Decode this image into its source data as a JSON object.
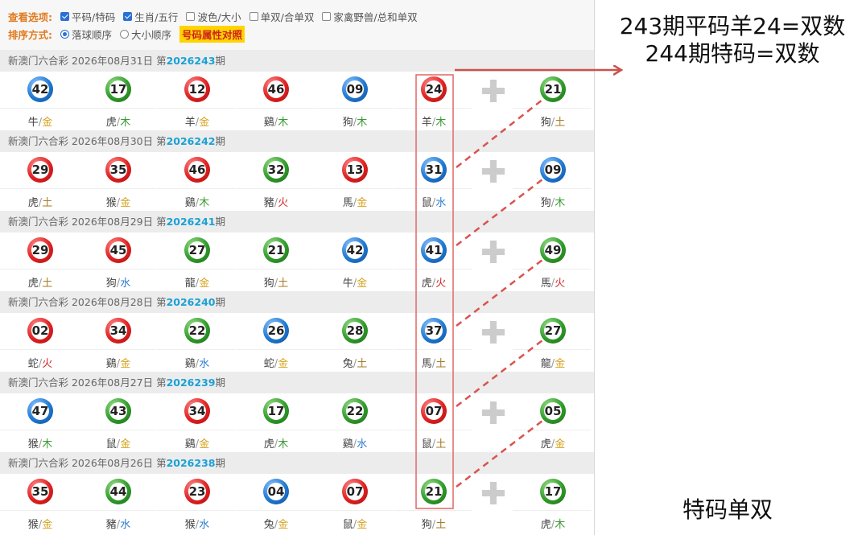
{
  "options": {
    "view_label": "查看选项:",
    "view_items": [
      {
        "label": "平码/特码",
        "checked": true
      },
      {
        "label": "生肖/五行",
        "checked": true
      },
      {
        "label": "波色/大小",
        "checked": false
      },
      {
        "label": "单双/合单双",
        "checked": false
      },
      {
        "label": "家禽野兽/总和单双",
        "checked": false
      }
    ],
    "sort_label": "排序方式:",
    "sort_items": [
      {
        "label": "落球顺序",
        "checked": true
      },
      {
        "label": "大小顺序",
        "checked": false
      }
    ],
    "highlight_link": "号码属性对照"
  },
  "draws": [
    {
      "title": "新澳门六合彩 2026年08月31日 第",
      "issue": "2026243",
      "suffix": "期",
      "balls": [
        {
          "num": "42",
          "color": "blue",
          "zodiac": "牛",
          "element": "金"
        },
        {
          "num": "17",
          "color": "green",
          "zodiac": "虎",
          "element": "木"
        },
        {
          "num": "12",
          "color": "red",
          "zodiac": "羊",
          "element": "金"
        },
        {
          "num": "46",
          "color": "red",
          "zodiac": "鷄",
          "element": "木"
        },
        {
          "num": "09",
          "color": "blue",
          "zodiac": "狗",
          "element": "木"
        },
        {
          "num": "24",
          "color": "red",
          "zodiac": "羊",
          "element": "木"
        }
      ],
      "special": {
        "num": "21",
        "color": "green",
        "zodiac": "狗",
        "element": "土"
      }
    },
    {
      "title": "新澳门六合彩 2026年08月30日 第",
      "issue": "2026242",
      "suffix": "期",
      "balls": [
        {
          "num": "29",
          "color": "red",
          "zodiac": "虎",
          "element": "土"
        },
        {
          "num": "35",
          "color": "red",
          "zodiac": "猴",
          "element": "金"
        },
        {
          "num": "46",
          "color": "red",
          "zodiac": "鷄",
          "element": "木"
        },
        {
          "num": "32",
          "color": "green",
          "zodiac": "豬",
          "element": "火"
        },
        {
          "num": "13",
          "color": "red",
          "zodiac": "馬",
          "element": "金"
        },
        {
          "num": "31",
          "color": "blue",
          "zodiac": "鼠",
          "element": "水"
        }
      ],
      "special": {
        "num": "09",
        "color": "blue",
        "zodiac": "狗",
        "element": "木"
      }
    },
    {
      "title": "新澳门六合彩 2026年08月29日 第",
      "issue": "2026241",
      "suffix": "期",
      "balls": [
        {
          "num": "29",
          "color": "red",
          "zodiac": "虎",
          "element": "土"
        },
        {
          "num": "45",
          "color": "red",
          "zodiac": "狗",
          "element": "水"
        },
        {
          "num": "27",
          "color": "green",
          "zodiac": "龍",
          "element": "金"
        },
        {
          "num": "21",
          "color": "green",
          "zodiac": "狗",
          "element": "土"
        },
        {
          "num": "42",
          "color": "blue",
          "zodiac": "牛",
          "element": "金"
        },
        {
          "num": "41",
          "color": "blue",
          "zodiac": "虎",
          "element": "火"
        }
      ],
      "special": {
        "num": "49",
        "color": "green",
        "zodiac": "馬",
        "element": "火"
      }
    },
    {
      "title": "新澳门六合彩 2026年08月28日 第",
      "issue": "2026240",
      "suffix": "期",
      "balls": [
        {
          "num": "02",
          "color": "red",
          "zodiac": "蛇",
          "element": "火"
        },
        {
          "num": "34",
          "color": "red",
          "zodiac": "鷄",
          "element": "金"
        },
        {
          "num": "22",
          "color": "green",
          "zodiac": "鷄",
          "element": "水"
        },
        {
          "num": "26",
          "color": "blue",
          "zodiac": "蛇",
          "element": "金"
        },
        {
          "num": "28",
          "color": "green",
          "zodiac": "兔",
          "element": "土"
        },
        {
          "num": "37",
          "color": "blue",
          "zodiac": "馬",
          "element": "土"
        }
      ],
      "special": {
        "num": "27",
        "color": "green",
        "zodiac": "龍",
        "element": "金"
      }
    },
    {
      "title": "新澳门六合彩 2026年08月27日 第",
      "issue": "2026239",
      "suffix": "期",
      "balls": [
        {
          "num": "47",
          "color": "blue",
          "zodiac": "猴",
          "element": "木"
        },
        {
          "num": "43",
          "color": "green",
          "zodiac": "鼠",
          "element": "金"
        },
        {
          "num": "34",
          "color": "red",
          "zodiac": "鷄",
          "element": "金"
        },
        {
          "num": "17",
          "color": "green",
          "zodiac": "虎",
          "element": "木"
        },
        {
          "num": "22",
          "color": "green",
          "zodiac": "鷄",
          "element": "水"
        },
        {
          "num": "07",
          "color": "red",
          "zodiac": "鼠",
          "element": "土"
        }
      ],
      "special": {
        "num": "05",
        "color": "green",
        "zodiac": "虎",
        "element": "金"
      }
    },
    {
      "title": "新澳门六合彩 2026年08月26日 第",
      "issue": "2026238",
      "suffix": "期",
      "balls": [
        {
          "num": "35",
          "color": "red",
          "zodiac": "猴",
          "element": "金"
        },
        {
          "num": "44",
          "color": "green",
          "zodiac": "豬",
          "element": "水"
        },
        {
          "num": "23",
          "color": "red",
          "zodiac": "猴",
          "element": "水"
        },
        {
          "num": "04",
          "color": "blue",
          "zodiac": "兔",
          "element": "金"
        },
        {
          "num": "07",
          "color": "red",
          "zodiac": "鼠",
          "element": "金"
        },
        {
          "num": "21",
          "color": "green",
          "zodiac": "狗",
          "element": "土"
        }
      ],
      "special": {
        "num": "17",
        "color": "green",
        "zodiac": "虎",
        "element": "木"
      }
    }
  ],
  "annotations": {
    "line1": "243期平码羊24=双数",
    "line2": "244期特码=双数",
    "bottom_label": "特码单双"
  },
  "colors": {
    "highlight_box": "#e06666",
    "dashed_line": "#d9534f",
    "arrow": "#c9524b"
  }
}
